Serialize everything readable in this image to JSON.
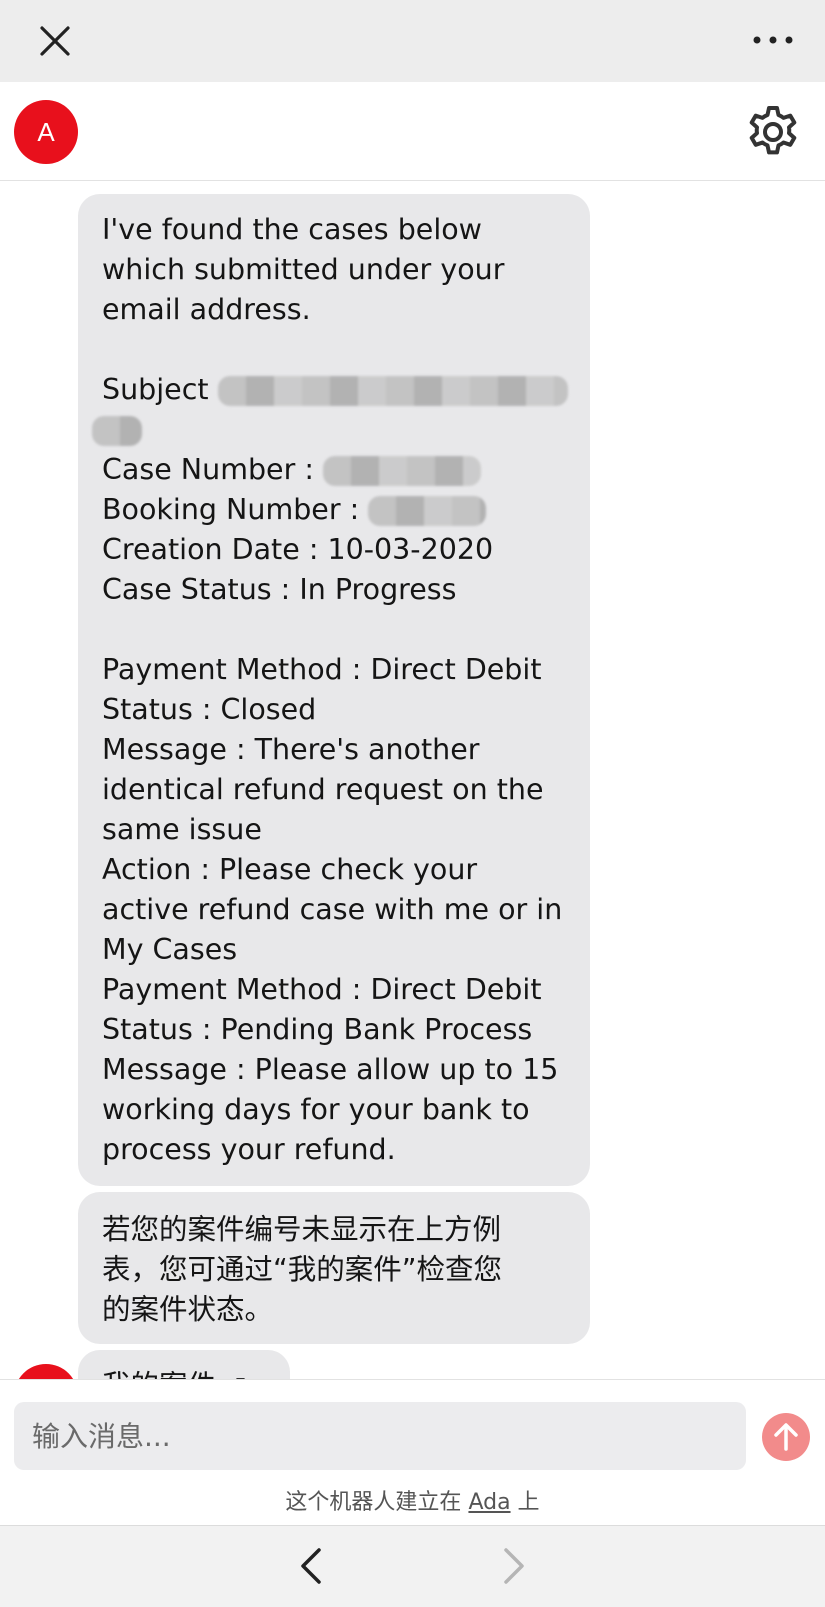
{
  "header": {
    "close_icon": "close-icon",
    "more_icon": "more-horizontal-icon",
    "avatar_letter": "A",
    "settings_icon": "gear-icon",
    "brand_color": "#e8101c"
  },
  "messages": {
    "intro": [
      "I've found the cases below",
      "which submitted under your",
      "email address."
    ],
    "subject_label": "Subject",
    "case_number_label": "Case Number :",
    "booking_number_label": "Booking Number :",
    "creation_date": "Creation Date : 10-03-2020",
    "case_status": "Case Status : In Progress",
    "refund_1": {
      "payment_method": "Payment Method : Direct Debit",
      "status": "Status : Closed",
      "message": [
        "Message : There's another",
        "identical refund request on the",
        "same issue"
      ],
      "action": [
        "Action : Please check your",
        "active refund case with me or in",
        "My Cases"
      ]
    },
    "refund_2": {
      "payment_method": "Payment Method : Direct Debit",
      "status": "Status : Pending Bank Process",
      "message": [
        "Message : Please allow up to 15",
        "working days for your bank to",
        "process your refund."
      ]
    },
    "hint": [
      "若您的案件编号未显示在上方例",
      "表，您可通过“我的案件”检查您",
      "的案件状态。"
    ],
    "my_cases_link": "我的案件 ↗"
  },
  "composer": {
    "placeholder": "输入消息...",
    "send_icon": "arrow-up-icon",
    "send_color": "#f28b8b",
    "powered_prefix": "这个机器人建立在",
    "powered_link": "Ada",
    "powered_suffix": "上"
  },
  "bottom_nav": {
    "back_icon": "chevron-left-icon",
    "forward_icon": "chevron-right-icon"
  }
}
